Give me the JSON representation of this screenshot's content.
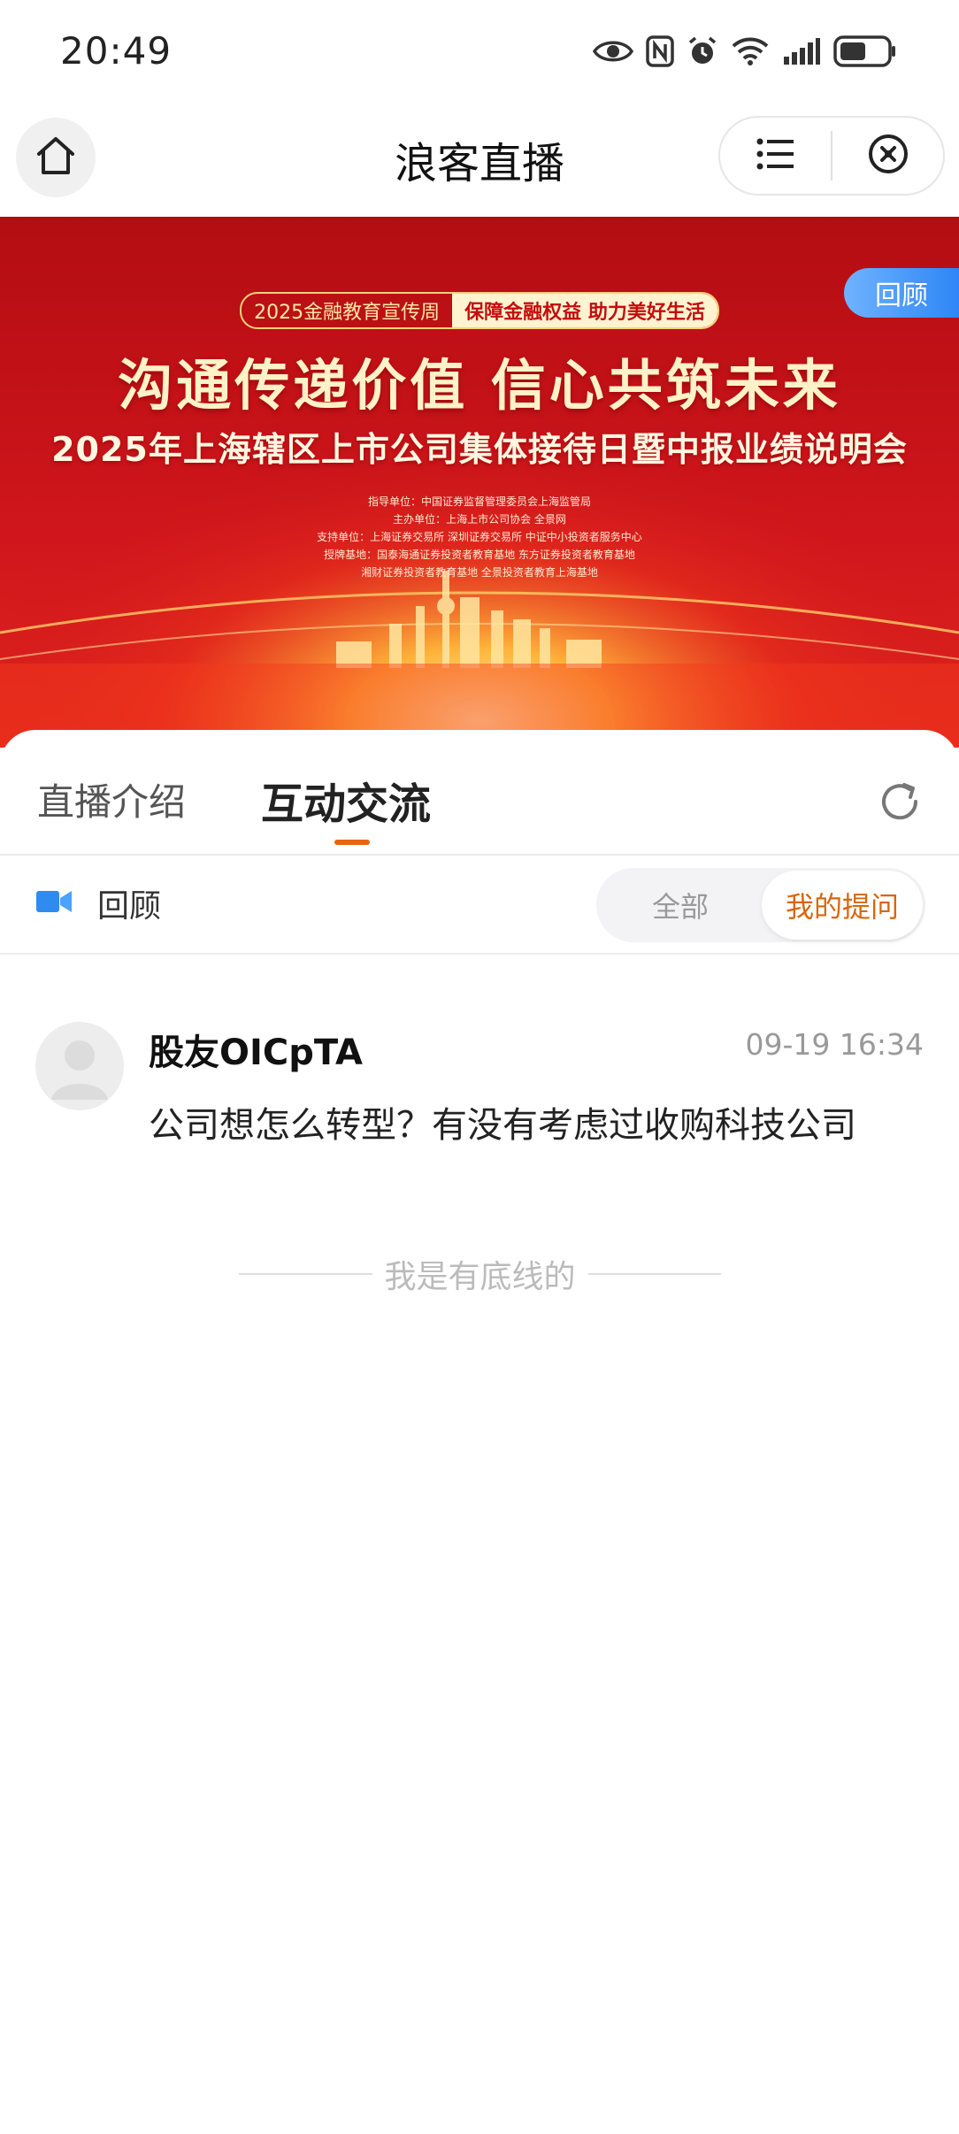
{
  "status_bar": {
    "time": "20:49",
    "icons": [
      "eye-icon",
      "nfc-icon",
      "alarm-icon",
      "wifi-icon",
      "signal-icon",
      "battery-icon"
    ]
  },
  "header": {
    "title": "浪客直播",
    "home_icon": "home-icon",
    "menu_icon": "list-icon",
    "close_icon": "close-circle-icon"
  },
  "banner": {
    "tag_left": "2025金融教育宣传周",
    "tag_right": "保障金融权益 助力美好生活",
    "slogan": "沟通传递价值 信心共筑未来",
    "main_title": "2025年上海辖区上市公司集体接待日暨中报业绩说明会",
    "orgs": [
      "指导单位：中国证券监督管理委员会上海监管局",
      "主办单位：上海上市公司协会  全景网",
      "支持单位：上海证券交易所  深圳证券交易所  中证中小投资者服务中心",
      "授牌基地：国泰海通证券投资者教育基地  东方证券投资者教育基地",
      "湘财证券投资者教育基地  全景投资者教育上海基地"
    ],
    "badge": "回顾"
  },
  "tabs": {
    "intro": "直播介绍",
    "chat": "互动交流",
    "active": "chat"
  },
  "filter": {
    "replay_label": "回顾",
    "option_all": "全部",
    "option_mine": "我的提问",
    "selected": "option_mine"
  },
  "comments": [
    {
      "user": "股友OICpTA",
      "time": "09-19 16:34",
      "text": "公司想怎么转型？有没有考虑过收购科技公司"
    }
  ],
  "footer_note": "我是有底线的",
  "colors": {
    "accent": "#d9660b",
    "underline": "#e8640e",
    "banner_red": "#c8121a",
    "badge_blue": "#2e86f6"
  }
}
